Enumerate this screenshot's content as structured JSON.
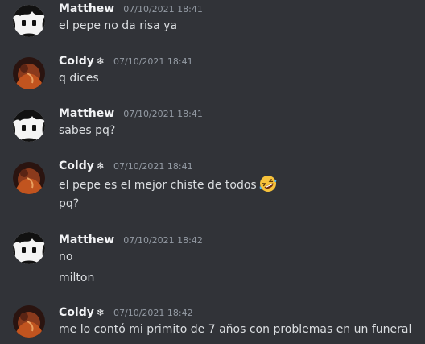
{
  "messages": [
    {
      "user": "Matthew",
      "avatar": "matthew",
      "snowflake": "",
      "timestamp": "07/10/2021 18:41",
      "lines": [
        "el pepe no da risa ya"
      ]
    },
    {
      "user": "Coldy",
      "avatar": "coldy",
      "snowflake": "❄",
      "timestamp": "07/10/2021 18:41",
      "lines": [
        "q dices"
      ]
    },
    {
      "user": "Matthew",
      "avatar": "matthew",
      "snowflake": "",
      "timestamp": "07/10/2021 18:41",
      "lines": [
        "sabes pq?"
      ]
    },
    {
      "user": "Coldy",
      "avatar": "coldy",
      "snowflake": "❄",
      "timestamp": "07/10/2021 18:41",
      "lines": [
        "el pepe es el mejor chiste de todos",
        "pq?"
      ],
      "emoji": "rofl-emoji"
    },
    {
      "user": "Matthew",
      "avatar": "matthew",
      "snowflake": "",
      "timestamp": "07/10/2021 18:42",
      "lines": [
        "no",
        "milton"
      ]
    },
    {
      "user": "Coldy",
      "avatar": "coldy",
      "snowflake": "❄",
      "timestamp": "07/10/2021 18:42",
      "lines": [
        "me lo contó mi primito de 7 años con problemas en un funeral"
      ]
    }
  ],
  "colors": {
    "background": "#313338",
    "username": "#f2f3f5",
    "text": "#dbdee1",
    "timestamp": "#949ba4"
  }
}
